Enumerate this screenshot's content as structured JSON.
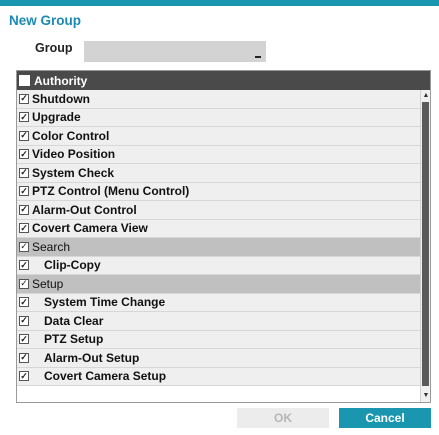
{
  "dialog": {
    "title": "New Group",
    "group_label": "Group",
    "group_value": "",
    "header": "Authority",
    "rows": [
      {
        "label": "Shutdown",
        "checked": true,
        "type": "item",
        "indent": false
      },
      {
        "label": "Upgrade",
        "checked": true,
        "type": "item",
        "indent": false
      },
      {
        "label": "Color Control",
        "checked": true,
        "type": "item",
        "indent": false
      },
      {
        "label": "Video Position",
        "checked": true,
        "type": "item",
        "indent": false
      },
      {
        "label": "System Check",
        "checked": true,
        "type": "item",
        "indent": false
      },
      {
        "label": "PTZ Control (Menu Control)",
        "checked": true,
        "type": "item",
        "indent": false
      },
      {
        "label": "Alarm-Out Control",
        "checked": true,
        "type": "item",
        "indent": false
      },
      {
        "label": "Covert Camera View",
        "checked": true,
        "type": "item",
        "indent": false
      },
      {
        "label": "Search",
        "checked": true,
        "type": "section",
        "indent": false
      },
      {
        "label": "Clip-Copy",
        "checked": true,
        "type": "item",
        "indent": true
      },
      {
        "label": "Setup",
        "checked": true,
        "type": "section",
        "indent": false
      },
      {
        "label": "System Time Change",
        "checked": true,
        "type": "item",
        "indent": true
      },
      {
        "label": "Data Clear",
        "checked": true,
        "type": "item",
        "indent": true
      },
      {
        "label": "PTZ Setup",
        "checked": true,
        "type": "item",
        "indent": true
      },
      {
        "label": "Alarm-Out Setup",
        "checked": true,
        "type": "item",
        "indent": true
      },
      {
        "label": "Covert Camera Setup",
        "checked": true,
        "type": "item",
        "indent": true
      }
    ],
    "ok_label": "OK",
    "cancel_label": "Cancel"
  },
  "colors": {
    "accent": "#1a96b0",
    "title": "#1a8ab4",
    "header_bg": "#4a4a4a",
    "section_bg": "#c0c0c0"
  }
}
